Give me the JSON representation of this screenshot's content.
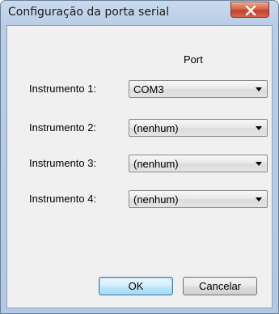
{
  "window": {
    "title": "Configuração da porta serial"
  },
  "table": {
    "port_header": "Port"
  },
  "rows": [
    {
      "label": "Instrumento 1:",
      "value": "COM3"
    },
    {
      "label": "Instrumento 2:",
      "value": "(nenhum)"
    },
    {
      "label": "Instrumento 3:",
      "value": "(nenhum)"
    },
    {
      "label": "Instrumento 4:",
      "value": "(nenhum)"
    }
  ],
  "buttons": {
    "ok_label": "OK",
    "cancel_label": "Cancelar"
  },
  "icons": {
    "close": "close-icon",
    "dropdown": "chevron-down-icon"
  },
  "colors": {
    "close_button": "#c2422a",
    "default_button_border": "#3c7fb1",
    "dialog_background": "#f0f0f0"
  }
}
